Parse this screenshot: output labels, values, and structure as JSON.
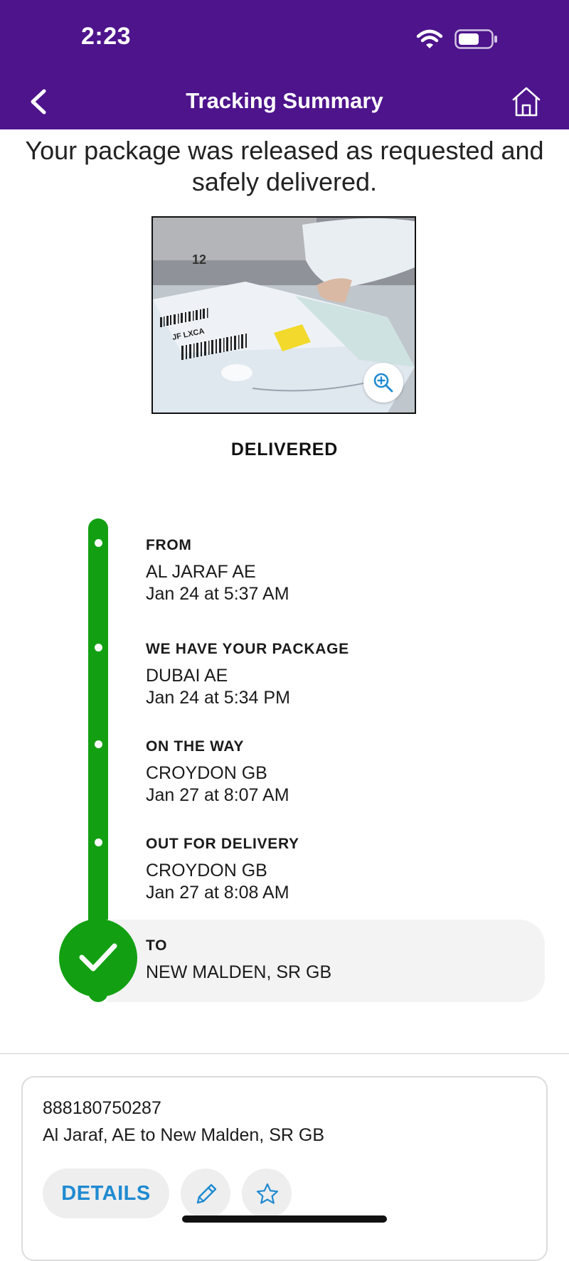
{
  "status_bar": {
    "time": "2:23",
    "icons": [
      "wifi-icon",
      "battery-icon"
    ]
  },
  "nav": {
    "title": "Tracking Summary",
    "back_icon": "chevron-left-icon",
    "home_icon": "home-icon"
  },
  "headline": "Your package was released as requested and safely delivered.",
  "photo": {
    "description_icon": "zoom-in-icon"
  },
  "delivery_status": "DELIVERED",
  "timeline": {
    "color": "#12a012",
    "steps": [
      {
        "label": "FROM",
        "location": "AL JARAF AE",
        "time": "Jan 24 at 5:37 AM"
      },
      {
        "label": "WE HAVE YOUR PACKAGE",
        "location": "DUBAI AE",
        "time": "Jan 24 at 5:34 PM"
      },
      {
        "label": "ON THE WAY",
        "location": "CROYDON GB",
        "time": "Jan 27 at 8:07 AM"
      },
      {
        "label": "OUT FOR DELIVERY",
        "location": "CROYDON GB",
        "time": "Jan 27 at 8:08 AM"
      }
    ],
    "final": {
      "label": "TO",
      "location": "NEW MALDEN, SR  GB",
      "icon": "checkmark-icon"
    }
  },
  "card": {
    "tracking_number": "888180750287",
    "route": "Al Jaraf, AE to New Malden, SR GB",
    "details_label": "DETAILS",
    "actions": [
      "pencil-icon",
      "star-icon"
    ]
  },
  "colors": {
    "brand_purple": "#4d148c",
    "accent_blue": "#1f8ad1",
    "success_green": "#12a012"
  }
}
